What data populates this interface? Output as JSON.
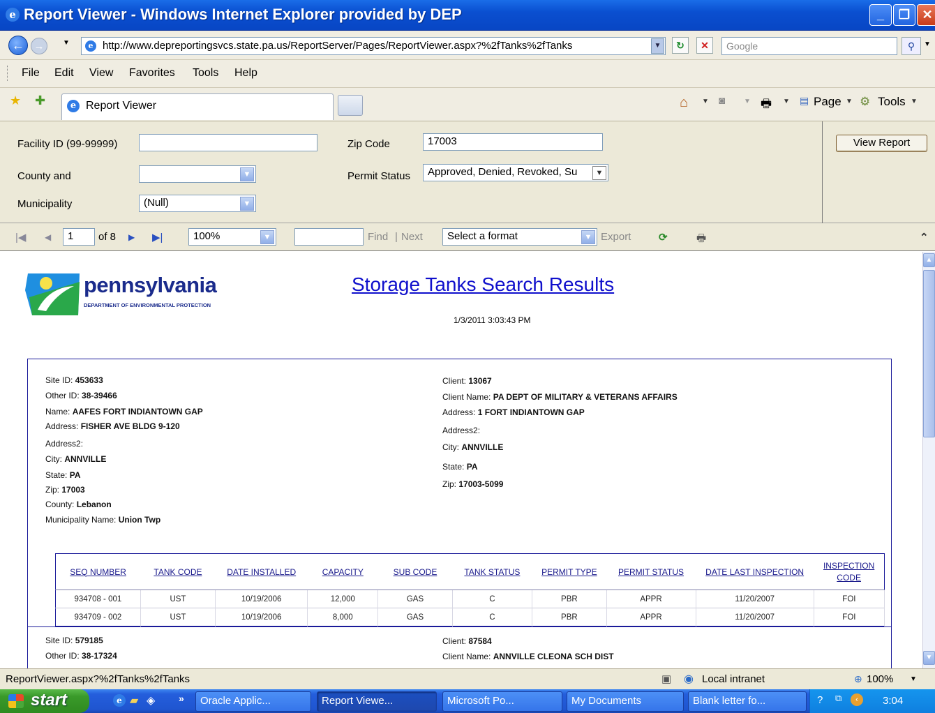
{
  "window": {
    "title": "Report Viewer - Windows Internet Explorer provided by DEP",
    "min_label": "_",
    "max_label": "❐",
    "close_label": "✕"
  },
  "address_bar": {
    "url": "http://www.depreportingsvcs.state.pa.us/ReportServer/Pages/ReportViewer.aspx?%2fTanks%2fTanks",
    "search_placeholder": "Google"
  },
  "menu": [
    "File",
    "Edit",
    "View",
    "Favorites",
    "Tools",
    "Help"
  ],
  "tab": {
    "label": "Report Viewer"
  },
  "command_bar": {
    "page_label": "Page",
    "tools_label": "Tools"
  },
  "parameters": {
    "facility_label": "Facility ID (99-99999)",
    "facility_value": "",
    "zip_label": "Zip Code",
    "zip_value": "17003",
    "county_label": "County and",
    "county_value": "",
    "permit_label": "Permit Status",
    "permit_value": "Approved, Denied, Revoked, Su",
    "municipality_label": "Municipality",
    "municipality_value": "(Null)",
    "view_report_label": "View Report"
  },
  "report_toolbar": {
    "current_page": "1",
    "of_pages": "of 8",
    "zoom": "100%",
    "find_label": "Find",
    "separator": "|",
    "next_label": "Next",
    "format_placeholder": "Select a format",
    "export_label": "Export"
  },
  "report": {
    "logo_name": "pennsylvania",
    "logo_dept": "DEPARTMENT OF ENVIRONMENTAL PROTECTION",
    "title": "Storage Tanks Search Results",
    "date": "1/3/2011 3:03:43 PM",
    "record1": {
      "site_id_label": "Site ID:",
      "site_id": "453633",
      "other_id_label": "Other ID:",
      "other_id": "38-39466",
      "name_label": "Name:",
      "name": "AAFES FORT INDIANTOWN GAP",
      "address_label": "Address:",
      "address": "FISHER AVE BLDG 9-120",
      "address2_label": "Address2:",
      "address2": "",
      "city_label": "City:",
      "city": "ANNVILLE",
      "state_label": "State:",
      "state": "PA",
      "zip_label": "Zip:",
      "zip": "17003",
      "county_label": "County:",
      "county": "Lebanon",
      "municipality_label": "Municipality Name:",
      "municipality": "Union Twp",
      "client_label": "Client:",
      "client": "13067",
      "client_name_label": "Client Name:",
      "client_name": "PA DEPT OF MILITARY & VETERANS AFFAIRS",
      "client_address_label": "Address:",
      "client_address": "1 FORT INDIANTOWN GAP",
      "client_address2_label": "Address2:",
      "client_address2": "",
      "client_city_label": "City:",
      "client_city": "ANNVILLE",
      "client_state_label": "State:",
      "client_state": "PA",
      "client_zip_label": "Zip:",
      "client_zip": "17003-5099"
    },
    "tank_table": {
      "headers": [
        "SEQ NUMBER",
        "TANK CODE",
        "DATE INSTALLED",
        "CAPACITY",
        "SUB CODE",
        "TANK STATUS",
        "PERMIT TYPE",
        "PERMIT STATUS",
        "DATE LAST INSPECTION",
        "INSPECTION CODE"
      ],
      "rows": [
        [
          "934708 - 001",
          "UST",
          "10/19/2006",
          "12,000",
          "GAS",
          "C",
          "PBR",
          "APPR",
          "11/20/2007",
          "FOI"
        ],
        [
          "934709 - 002",
          "UST",
          "10/19/2006",
          "8,000",
          "GAS",
          "C",
          "PBR",
          "APPR",
          "11/20/2007",
          "FOI"
        ]
      ]
    },
    "record2": {
      "site_id_label": "Site ID:",
      "site_id": "579185",
      "other_id_label": "Other ID:",
      "other_id": "38-17324",
      "client_label": "Client:",
      "client": "87584",
      "client_name_label": "Client Name:",
      "client_name": "ANNVILLE CLEONA SCH DIST"
    }
  },
  "status_bar": {
    "text": "ReportViewer.aspx?%2fTanks%2fTanks",
    "zone": "Local intranet",
    "zoom": "100%"
  },
  "taskbar": {
    "start_label": "start",
    "tasks": [
      "Oracle Applic...",
      "Report Viewe...",
      "Microsoft Po...",
      "My Documents",
      "Blank letter fo..."
    ],
    "clock": "3:04"
  },
  "colors": {
    "title_bar": "#0a4fd0",
    "report_link": "#1010cc",
    "record_border": "#1a1a99",
    "taskbar": "#245edc",
    "start": "#3a9a2a"
  },
  "icons": [
    "ie-icon",
    "back-icon",
    "forward-icon",
    "refresh-icon",
    "stop-icon",
    "search-icon",
    "favorites-star-icon",
    "add-favorites-icon",
    "home-icon",
    "feeds-icon",
    "print-icon",
    "page-icon",
    "tools-gear-icon",
    "first-page-icon",
    "prev-page-icon",
    "next-page-icon",
    "last-page-icon",
    "refresh-report-icon",
    "print-report-icon",
    "collapse-icon",
    "windows-flag-icon"
  ]
}
